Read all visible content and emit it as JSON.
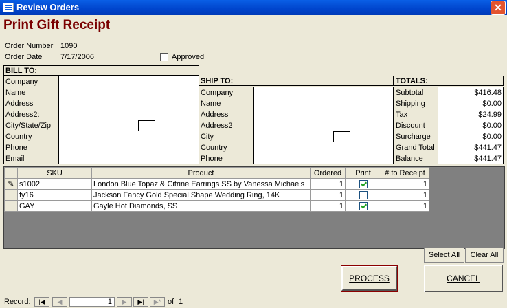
{
  "window": {
    "title": "Review Orders",
    "close": "✕"
  },
  "heading": "Print Gift Receipt",
  "order": {
    "number_label": "Order Number",
    "number": "1090",
    "date_label": "Order Date",
    "date": "7/17/2006",
    "approved_label": "Approved"
  },
  "bill_to": {
    "title": "BILL TO:",
    "labels": [
      "Company",
      "Name",
      "Address",
      "Address2:",
      "City/State/Zip",
      "Country",
      "Phone",
      "Email"
    ]
  },
  "ship_to": {
    "title": "SHIP TO:",
    "labels": [
      "Company",
      "Name",
      "Address",
      "Address2",
      "City",
      "Country",
      "Phone"
    ]
  },
  "totals": {
    "title": "TOTALS:",
    "labels": [
      "Subtotal",
      "Shipping",
      "Tax",
      "Discount",
      "Surcharge",
      "Grand Total",
      "Balance"
    ],
    "values": [
      "$416.48",
      "$0.00",
      "$24.99",
      "$0.00",
      "$0.00",
      "$441.47",
      "$441.47"
    ]
  },
  "lines": {
    "headers": [
      "SKU",
      "Product",
      "Ordered",
      "Print",
      "# to Receipt"
    ],
    "rows": [
      {
        "sku": "s1002",
        "product": "London Blue Topaz & Citrine Earrings SS by Vanessa Michaels",
        "ordered": "1",
        "print": true,
        "receipt": "1"
      },
      {
        "sku": "fy16",
        "product": "Jackson Fancy Gold Special Shape Wedding Ring, 14K",
        "ordered": "1",
        "print": false,
        "receipt": "1"
      },
      {
        "sku": "GAY",
        "product": "Gayle Hot Diamonds, SS",
        "ordered": "1",
        "print": true,
        "receipt": "1"
      }
    ]
  },
  "buttons": {
    "select_all": "Select All",
    "clear_all": "Clear All",
    "process": "PROCESS",
    "cancel": "CANCEL"
  },
  "record": {
    "label": "Record:",
    "current": "1",
    "of": "of",
    "total": "1"
  }
}
